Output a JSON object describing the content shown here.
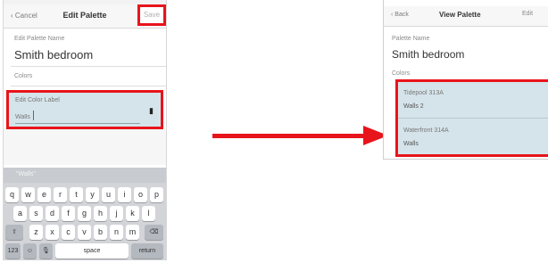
{
  "left_screen": {
    "nav": {
      "back": "Cancel",
      "title": "Edit Palette",
      "save": "Save"
    },
    "palette_name_label": "Edit Palette Name",
    "palette_name_value": "Smith bedroom",
    "colors_label": "Colors",
    "color_label_field": {
      "label": "Edit Color Label",
      "value": "Walls"
    },
    "keyboard": {
      "suggestion": "\"Walls\"",
      "row1": [
        "q",
        "w",
        "e",
        "r",
        "t",
        "y",
        "u",
        "i",
        "o",
        "p"
      ],
      "row2": [
        "a",
        "s",
        "d",
        "f",
        "g",
        "h",
        "j",
        "k",
        "l"
      ],
      "row3": [
        "z",
        "x",
        "c",
        "v",
        "b",
        "n",
        "m"
      ],
      "shift": "⇧",
      "backspace": "⌫",
      "numbers": "123",
      "emoji": "☺",
      "mic": "🎙",
      "space": "space",
      "return": "return"
    }
  },
  "right_screen": {
    "nav": {
      "back": "Back",
      "title": "View Palette",
      "edit": "Edit"
    },
    "palette_name_label": "Palette Name",
    "palette_name_value": "Smith bedroom",
    "colors_label": "Colors",
    "colors": [
      {
        "name": "Tidepool 313A",
        "label": "Walls 2"
      },
      {
        "name": "Waterfront 314A",
        "label": "Walls"
      }
    ]
  },
  "colors": {
    "highlight": "#e8141b",
    "selected_row_bg": "#d5e4ea"
  }
}
